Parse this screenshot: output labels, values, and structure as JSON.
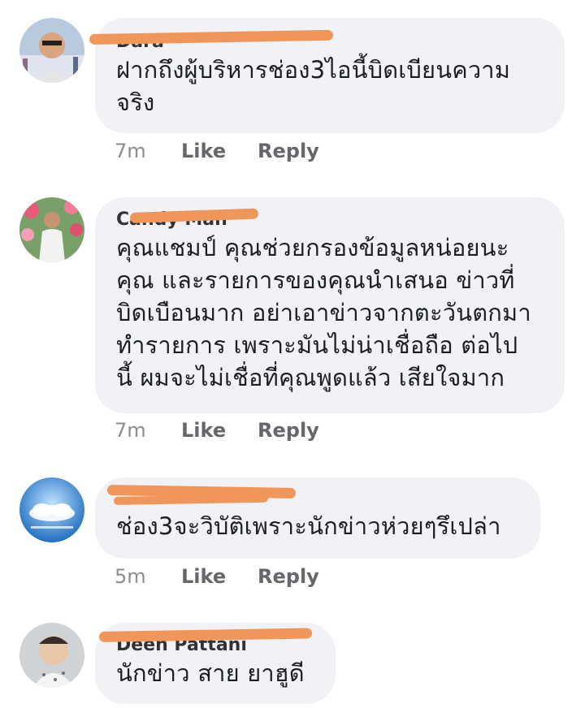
{
  "comments": [
    {
      "author": "Dara",
      "text": "ฝากถึงผู้บริหารช่อง3ไอนี้บิดเบียนความ\nจริง",
      "time": "7m",
      "like_label": "Like",
      "reply_label": "Reply"
    },
    {
      "author": "Candy Man",
      "text": "คุณแชมป์ คุณช่วยกรองข้อมูลหน่อยนะ\nคุณ และรายการของคุณนำเสนอ ข่าวที่\nบิดเบือนมาก อย่าเอาข่าวจากตะวันตกมา\nทำรายการ เพราะมันไม่น่าเชื่อถือ ต่อไป\nนี้ ผมจะไม่เชื่อที่คุณพูดแล้ว เสียใจมาก",
      "time": "7m",
      "like_label": "Like",
      "reply_label": "Reply"
    },
    {
      "author": "",
      "text": "ช่อง3จะวิบัติเพราะนักข่าวห่วยๆรึเปล่า",
      "time": "5m",
      "like_label": "Like",
      "reply_label": "Reply"
    },
    {
      "author": "Deen Pattani",
      "text": "นักข่าว สาย ยาฮูดี"
    }
  ],
  "colors": {
    "bubble": "#f0f2f5",
    "redaction": "#f0965a",
    "action": "#65676b",
    "time": "#8a8d91"
  }
}
